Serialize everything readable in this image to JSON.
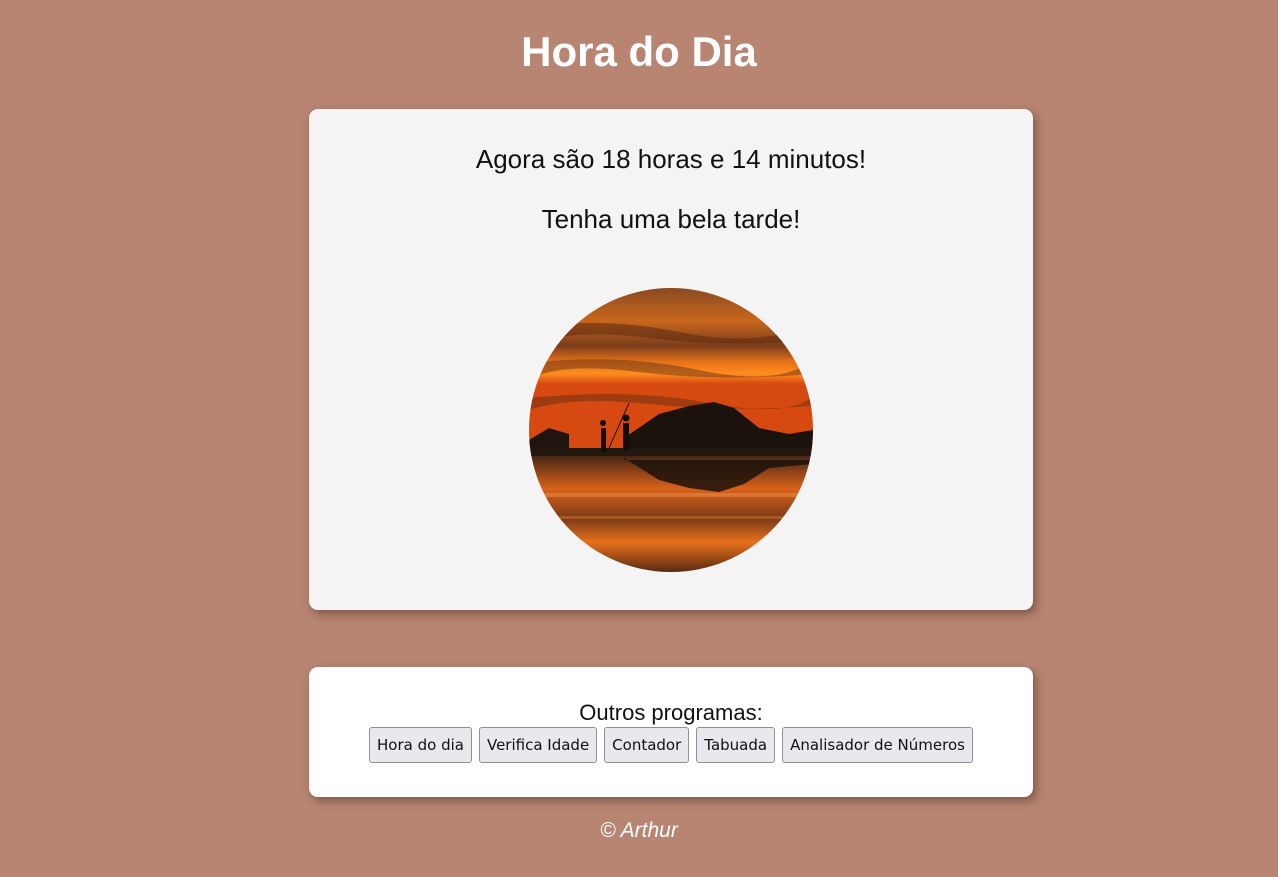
{
  "header": {
    "title": "Hora do Dia"
  },
  "main": {
    "time_message": "Agora são 18 horas e 14 minutos!",
    "greeting": "Tenha uma bela tarde!",
    "image": {
      "icon": "sunset-photo",
      "alt": "sunset photo"
    }
  },
  "nav": {
    "title": "Outros programas:",
    "buttons": [
      {
        "label": "Hora do dia"
      },
      {
        "label": "Verifica Idade"
      },
      {
        "label": "Contador"
      },
      {
        "label": "Tabuada"
      },
      {
        "label": "Analisador de Números"
      }
    ]
  },
  "footer": {
    "text": "© Arthur"
  },
  "colors": {
    "background": "#b78572",
    "card_main": "#f4f4f4",
    "card_nav": "#ffffff",
    "title_text": "#ffffff"
  }
}
